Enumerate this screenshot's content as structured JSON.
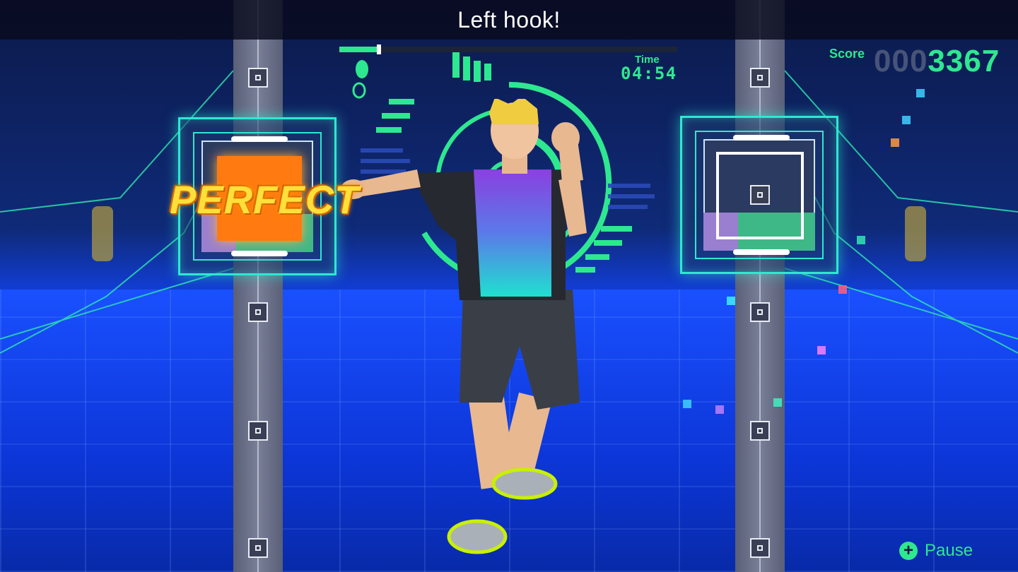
{
  "header": {
    "instruction": "Left hook!"
  },
  "progress": {
    "fraction": 0.11
  },
  "time": {
    "label": "Time",
    "value": "04:54"
  },
  "score": {
    "label": "Score",
    "padding": "000",
    "value": "3367"
  },
  "feedback": {
    "judgement": "PERFECT"
  },
  "controls": {
    "pause_label": "Pause",
    "pause_icon": "plus-button-icon"
  },
  "colors": {
    "accent": "#2ee890",
    "perfect": "#ffe03a",
    "target_active": "#ff7a10",
    "neon": "#2ee8d0"
  },
  "icons": {
    "footwork": "footprints-icon",
    "judgement_target_left": "active-target-icon",
    "judgement_target_right": "idle-target-icon"
  }
}
